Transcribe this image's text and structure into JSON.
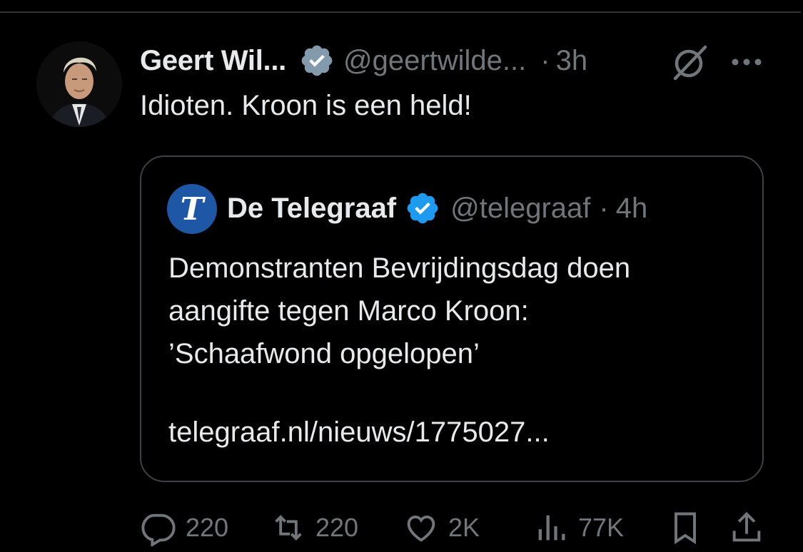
{
  "tweet": {
    "author_name": "Geert Wil...",
    "author_handle": "@geertwilde...",
    "separator": "·",
    "time": "3h",
    "text": "Idioten. Kroon is een held!"
  },
  "quoted_tweet": {
    "logo_letter": "T",
    "author_name": "De Telegraaf",
    "author_handle": "@telegraaf",
    "separator": "·",
    "time": "4h",
    "text_lines": [
      "Demonstranten Bevrijdingsdag doen",
      "aangifte tegen Marco Kroon:",
      "’Schaafwond opgelopen’"
    ],
    "link": "telegraaf.nl/nieuws/1775027..."
  },
  "actions": {
    "replies": "220",
    "reposts": "220",
    "likes": "2K",
    "views": "77K"
  },
  "icons": {
    "avatar": "profile-photo",
    "verified_main": "gray-verified-badge",
    "verified_quote": "blue-verified-badge",
    "grok": "grok-icon",
    "more": "more-icon",
    "reply": "reply-icon",
    "repost": "repost-icon",
    "like": "like-icon",
    "views": "views-icon",
    "bookmark": "bookmark-icon",
    "share": "share-icon"
  },
  "colors": {
    "background": "#000000",
    "primary_text": "#e7e9ea",
    "secondary_text": "#71767b",
    "border": "#3d4145",
    "verified_gray": "#829aab",
    "verified_blue": "#1d9bf0",
    "telegraaf_blue": "#1d57a6"
  }
}
